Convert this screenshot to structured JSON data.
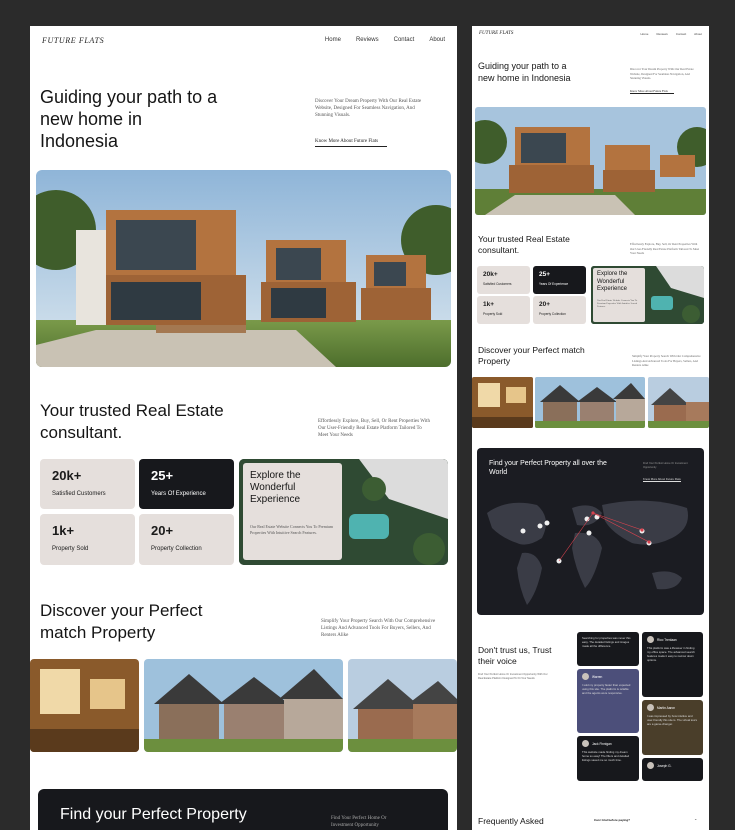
{
  "left": {
    "logo": "FUTURE FLATS",
    "nav": [
      "Home",
      "Reviews",
      "Contact",
      "About"
    ],
    "hero": {
      "title": "Guiding your path to a new home in Indonesia",
      "description": "Discover Your Dream Property With Our Real Estate Website, Designed For Seamless Navigation, And Stunning Visuals.",
      "link": "Know More About Future Flats"
    },
    "consultant": {
      "title": "Your trusted Real Estate consultant.",
      "description": "Effortlessly Explore, Buy, Sell, Or Rent Properties With Our User-Friendly Real Estate Platform Tailored To Meet Your Needs"
    },
    "stats": [
      {
        "num": "20k+",
        "label": "Satisfied Customers"
      },
      {
        "num": "25+",
        "label": "Years Of Experience"
      },
      {
        "num": "1k+",
        "label": "Property  Sold"
      },
      {
        "num": "20+",
        "label": "Property Collection"
      }
    ],
    "explore": {
      "title": "Explore the Wonderful Experience",
      "description": "Our Real Estate Website Connects You To Premium Properties With Intuitive Search Features."
    },
    "discover": {
      "title": "Discover your Perfect match Property",
      "description": "Simplify Your Property Search With Our Comprehensive Listings And Advanced Tools For Buyers, Sellers, And Renters Alike"
    },
    "find": {
      "title": "Find your Perfect Property",
      "description": "Find Your Perfect Home Or Investment Opportunity"
    }
  },
  "right": {
    "logo": "FUTURE FLATS",
    "nav": [
      "Home",
      "Reviews",
      "Contact",
      "About"
    ],
    "hero": {
      "title": "Guiding your path to a new home in Indonesia",
      "description": "Discover Your Dream Property With Our Real Estate Website, Designed For Seamless Navigation, And Stunning Visuals.",
      "link": "Know More About Future Flats"
    },
    "consultant": {
      "title": "Your trusted Real Estate consultant.",
      "description": "Effortlessly Explore, Buy, Sell, Or Rent Properties With Our User-Friendly Real Estate Platform Tailored To Meet Your Needs"
    },
    "stats": [
      {
        "num": "20k+",
        "label": "Satisfied Customers"
      },
      {
        "num": "25+",
        "label": "Years Of Experience"
      },
      {
        "num": "1k+",
        "label": "Property  Sold"
      },
      {
        "num": "20+",
        "label": "Property Collection"
      }
    ],
    "explore": {
      "title": "Explore the Wonderful Experience",
      "description": "Our Real Estate Website Connects You To Premium Properties With Intuitive Search Features."
    },
    "discover": {
      "title": "Discover your Perfect match Property",
      "description": "Simplify Your Property Search With Our Comprehensive Listings And Advanced Tools For Buyers, Sellers, And Renters Alike"
    },
    "map": {
      "title": "Find your Perfect Property all over the World",
      "description": "Find Your Perfect Home Or Investment Opportunity",
      "link": "Know More About Future Flats"
    },
    "trust": {
      "title": "Don't trust us, Trust their voice",
      "description": "Find Your Perfect Home Or Investment Opportunity With Our Real Estate Platform Designed To Fit Your Needs"
    },
    "testimonials": [
      {
        "name": "",
        "text": "Searching for properties was never this easy. The detailed listings and images made all the difference."
      },
      {
        "name": "Rico Trenlaan",
        "text": "This platform was a lifesaver in finding my office space. The advanced search features made it easy to narrow down options."
      },
      {
        "name": "Warren",
        "text": "I sold my property faster than expected using this site. The platform is reliable and the agents were responsive."
      },
      {
        "name": "Martin Aaron",
        "text": "I was impressed by how intuitive and user-friendly this site is. The virtual tours are a game-changer."
      },
      {
        "name": "Jack Finnigan",
        "text": "This website made finding my dream home so easy! The filters and detailed listings saved me so much time."
      },
      {
        "name": "Joseph G.",
        "text": ""
      }
    ],
    "faq": {
      "title": "Frequently Asked",
      "question": "Can I trial before paying?"
    }
  }
}
